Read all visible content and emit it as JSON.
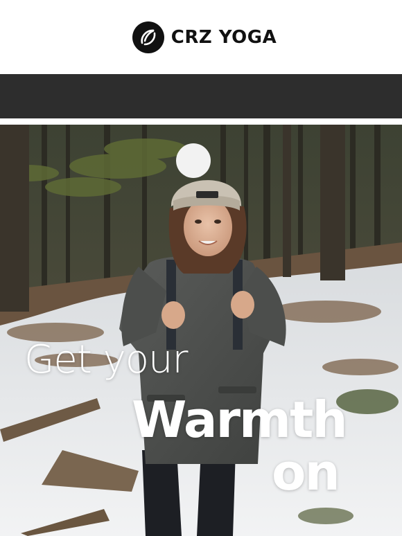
{
  "brand": {
    "name": "CRZ YOGA",
    "logo_icon": "crz-yoga-circle-logo"
  },
  "navbar": {
    "color": "#2d2d2d"
  },
  "hero": {
    "headline_line1": "Get your",
    "headline_line2": "Warmth",
    "headline_line3": "on",
    "text_color": "#ffffff"
  }
}
